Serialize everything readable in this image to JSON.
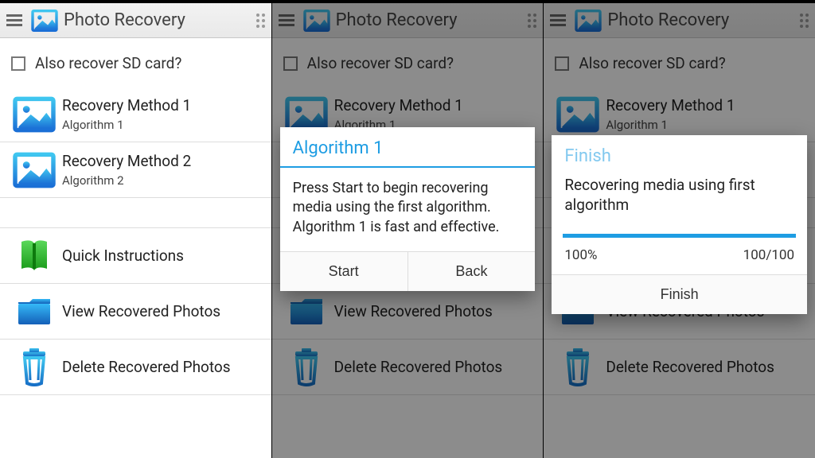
{
  "app": {
    "title": "Photo Recovery"
  },
  "sd_label": "Also recover SD card?",
  "methods": [
    {
      "label": "Recovery Method 1",
      "sub": "Algorithm 1"
    },
    {
      "label": "Recovery Method 2",
      "sub": "Algorithm 2"
    }
  ],
  "actions": {
    "instructions": "Quick Instructions",
    "view": "View Recovered Photos",
    "delete": "Delete Recovered Photos"
  },
  "dialog_algo": {
    "title": "Algorithm 1",
    "body": "Press Start to begin recovering media using the first algorithm. Algorithm 1 is fast and effective.",
    "start": "Start",
    "back": "Back"
  },
  "dialog_progress": {
    "faded_title": "Finish",
    "body": "Recovering media using first algorithm",
    "percent": "100%",
    "count": "100/100",
    "finish": "Finish"
  }
}
